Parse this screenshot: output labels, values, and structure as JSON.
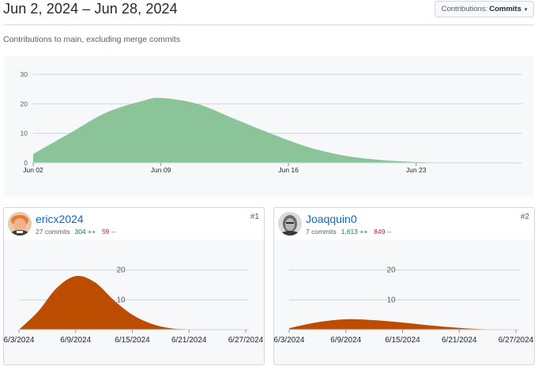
{
  "header": {
    "date_range": "Jun 2, 2024 – Jun 28, 2024",
    "contributions_label": "Contributions:",
    "contributions_value": "Commits",
    "caret": "▾",
    "subtitle": "Contributions to main, excluding merge commits"
  },
  "colors": {
    "main_area": "#8cc49a",
    "user_area": "#bc4c00",
    "link": "#0969da",
    "additions": "#1a7f37",
    "deletions": "#cf222e"
  },
  "chart_data": [
    {
      "type": "area",
      "title": "",
      "xlabel": "",
      "ylabel": "",
      "x_ticks": [
        "Jun 02",
        "Jun 09",
        "Jun 16",
        "Jun 23"
      ],
      "y_ticks": [
        "0",
        "10",
        "20",
        "30"
      ],
      "ylim": [
        0,
        30
      ],
      "grid": true,
      "series": [
        {
          "x": [
            "2024-06-02",
            "2024-06-04",
            "2024-06-06",
            "2024-06-08",
            "2024-06-09",
            "2024-06-11",
            "2024-06-13",
            "2024-06-15",
            "2024-06-17",
            "2024-06-19",
            "2024-06-21",
            "2024-06-23",
            "2024-06-25",
            "2024-06-27"
          ],
          "values": [
            3,
            10,
            17,
            21,
            22,
            20,
            15,
            10,
            5.5,
            2.5,
            1,
            0.3,
            0.05,
            0
          ]
        }
      ]
    },
    {
      "type": "area",
      "title": "",
      "x_ticks": [
        "6/3/2024",
        "6/9/2024",
        "6/15/2024",
        "6/21/2024",
        "6/27/2024"
      ],
      "y_ticks": [
        "10",
        "20"
      ],
      "ylim": [
        0,
        30
      ],
      "grid": true,
      "series": [
        {
          "x": [
            "2024-06-03",
            "2024-06-05",
            "2024-06-07",
            "2024-06-09",
            "2024-06-11",
            "2024-06-13",
            "2024-06-15",
            "2024-06-17",
            "2024-06-19",
            "2024-06-21",
            "2024-06-23",
            "2024-06-27"
          ],
          "values": [
            0,
            6,
            14,
            18,
            16,
            10,
            5,
            2,
            0.5,
            0.1,
            0,
            0
          ]
        }
      ]
    },
    {
      "type": "area",
      "title": "",
      "x_ticks": [
        "6/3/2024",
        "6/9/2024",
        "6/15/2024",
        "6/21/2024",
        "6/27/2024"
      ],
      "y_ticks": [
        "10",
        "20"
      ],
      "ylim": [
        0,
        30
      ],
      "grid": true,
      "series": [
        {
          "x": [
            "2024-06-03",
            "2024-06-06",
            "2024-06-09",
            "2024-06-12",
            "2024-06-15",
            "2024-06-18",
            "2024-06-21",
            "2024-06-24",
            "2024-06-27"
          ],
          "values": [
            0.5,
            2.5,
            3.5,
            3.2,
            2.4,
            1.4,
            0.6,
            0.1,
            0
          ]
        }
      ]
    }
  ],
  "contributors": [
    {
      "username": "ericx2024",
      "commits": "27 commits",
      "additions": "304 ++",
      "deletions": "59 --",
      "rank": "#1"
    },
    {
      "username": "Joaqquin0",
      "commits": "7 commits",
      "additions": "1,613 ++",
      "deletions": "849 --",
      "rank": "#2"
    }
  ]
}
